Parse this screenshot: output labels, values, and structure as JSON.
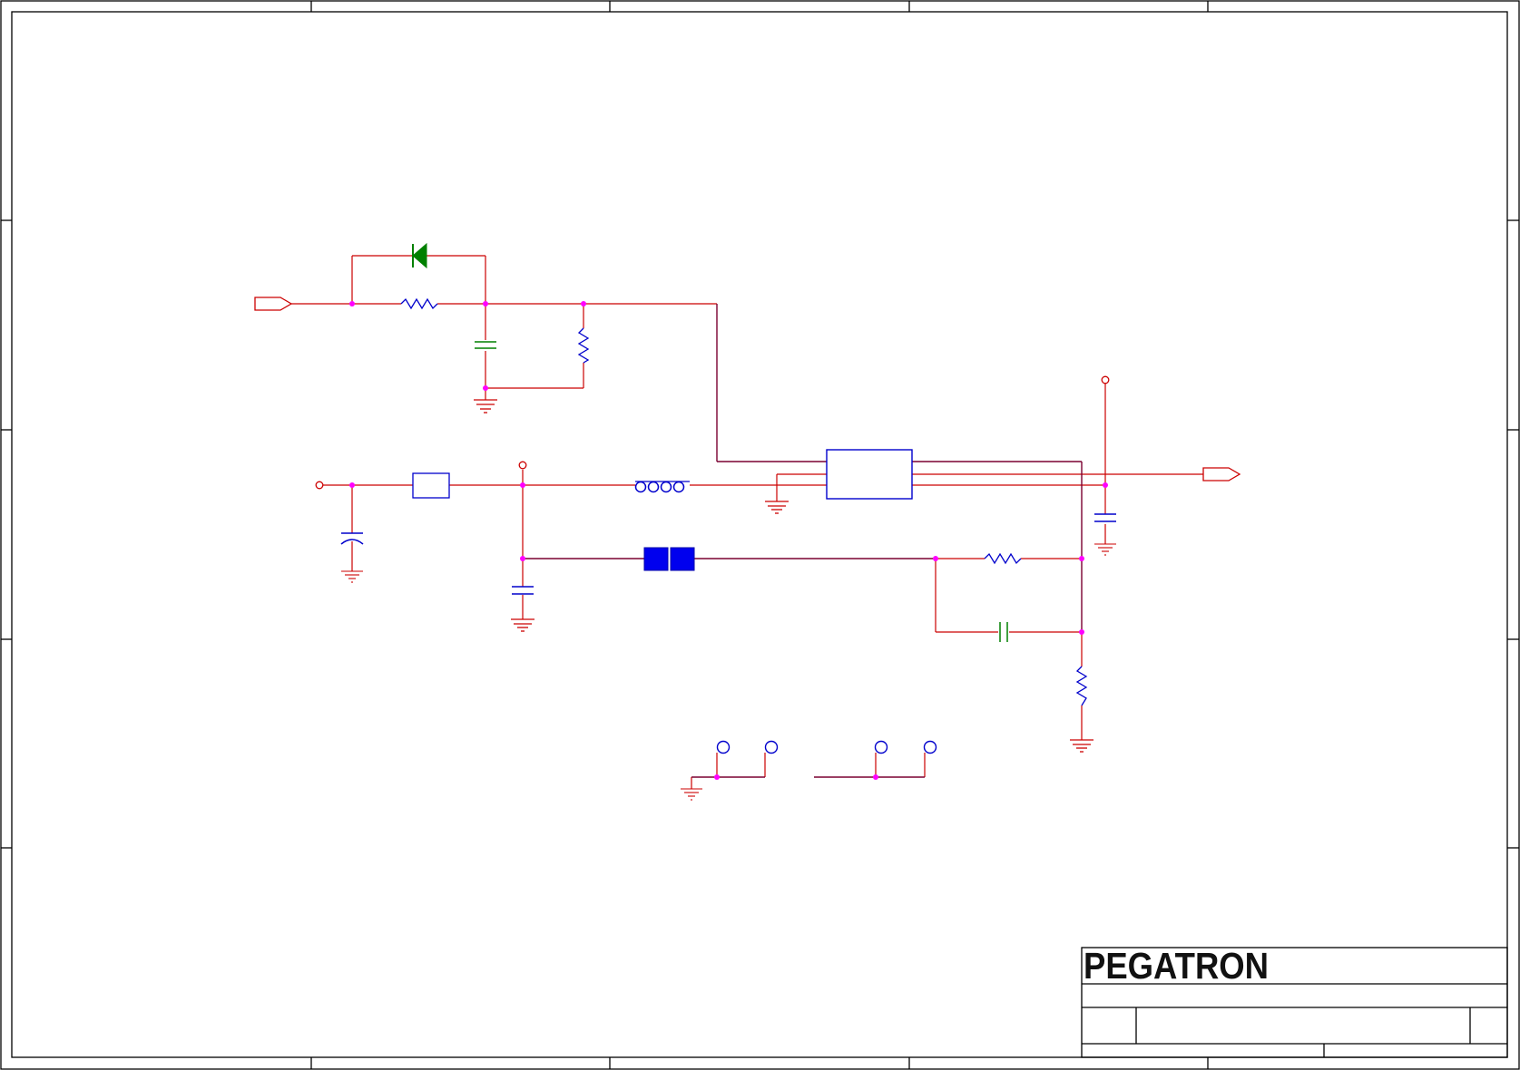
{
  "title_block": {
    "company": "PEGATRON",
    "title": "",
    "size": "",
    "document_number": "",
    "rev": "",
    "date": "",
    "sheet": ""
  },
  "colors": {
    "frame": "#000000",
    "wire": "#cc0000",
    "bus": "#7a0030",
    "junction": "#ff00ff",
    "component": "#0000cc",
    "diode": "#008000",
    "capacitor_small": "#008000",
    "ground": "#cc0000"
  },
  "components": [
    {
      "kind": "input-port"
    },
    {
      "kind": "diode"
    },
    {
      "kind": "resistor"
    },
    {
      "kind": "capacitor"
    },
    {
      "kind": "resistor"
    },
    {
      "kind": "ic"
    },
    {
      "kind": "inductor"
    },
    {
      "kind": "fuse"
    },
    {
      "kind": "ferrite-bead"
    },
    {
      "kind": "output-port"
    },
    {
      "kind": "test-point"
    },
    {
      "kind": "mounting-hole"
    }
  ]
}
